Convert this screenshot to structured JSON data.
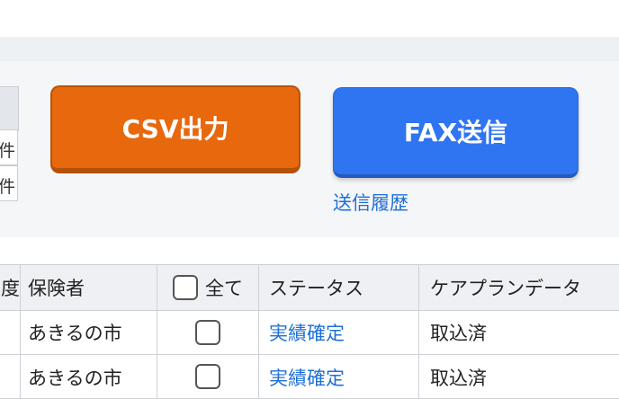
{
  "summary_table": {
    "row1_suffix": "件",
    "row2_suffix": "件"
  },
  "actions": {
    "csv_label": "CSV出力",
    "fax_label": "FAX送信",
    "history_link": "送信履歴"
  },
  "table": {
    "headers": {
      "col0": "度",
      "insurer": "保険者",
      "select_all": "全て",
      "status": "ステータス",
      "careplan": "ケアプランデータ"
    },
    "rows": [
      {
        "insurer": "あきるの市",
        "status": "実績確定",
        "careplan": "取込済"
      },
      {
        "insurer": "あきるの市",
        "status": "実績確定",
        "careplan": "取込済"
      }
    ]
  },
  "colors": {
    "csv_button": "#e8680e",
    "fax_button": "#2f74f0",
    "link": "#1f6fd6"
  }
}
